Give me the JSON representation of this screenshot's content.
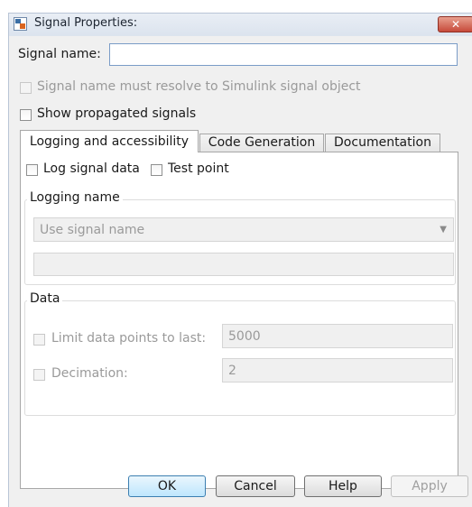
{
  "window": {
    "title": "Signal Properties:",
    "close_label": "✕"
  },
  "form": {
    "signal_name_label": "Signal name:",
    "signal_name_value": "",
    "resolve_label": "Signal name must resolve to Simulink signal object",
    "show_propagated_label": "Show propagated signals"
  },
  "tabs": [
    {
      "label": "Logging and accessibility",
      "active": true
    },
    {
      "label": "Code Generation",
      "active": false
    },
    {
      "label": "Documentation",
      "active": false
    }
  ],
  "logging": {
    "log_signal_label": "Log signal data",
    "test_point_label": "Test point",
    "logging_name_group": "Logging name",
    "logging_name_select": "Use signal name",
    "logging_name_value": "",
    "data_group": "Data",
    "limit_label": "Limit data points to last:",
    "limit_value": "5000",
    "decimation_label": "Decimation:",
    "decimation_value": "2"
  },
  "buttons": {
    "ok": "OK",
    "cancel": "Cancel",
    "help": "Help",
    "apply": "Apply"
  },
  "colors": {
    "close": "#c74a3a",
    "accent": "#3c7fb1"
  }
}
